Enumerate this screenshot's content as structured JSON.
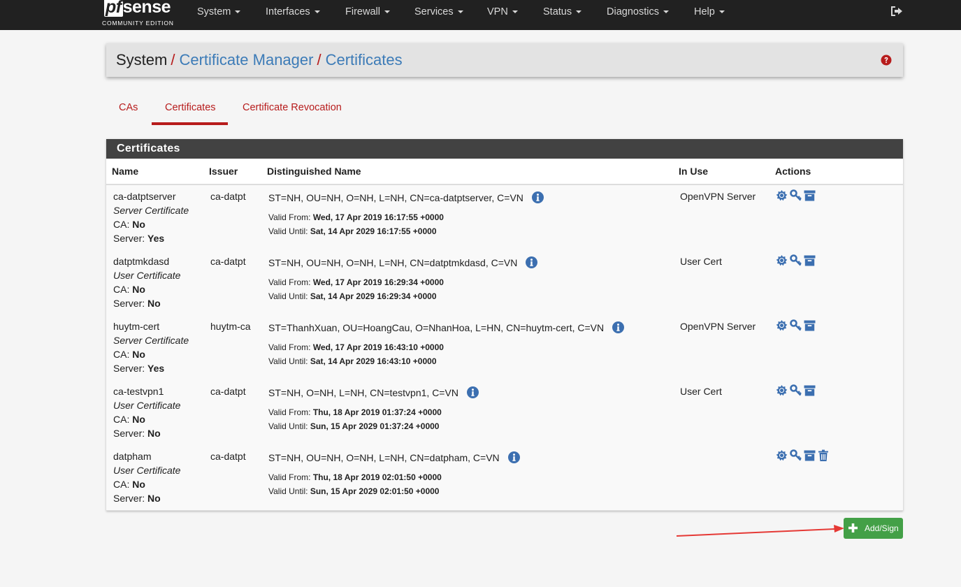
{
  "brand": {
    "name_pf": "pf",
    "name_rest": "sense",
    "edition": "COMMUNITY EDITION"
  },
  "nav": {
    "items": [
      "System",
      "Interfaces",
      "Firewall",
      "Services",
      "VPN",
      "Status",
      "Diagnostics",
      "Help"
    ],
    "logout_icon": "sign-out-icon"
  },
  "breadcrumb": {
    "root": "System",
    "level1": "Certificate Manager",
    "level2": "Certificates",
    "separator": "/",
    "help_icon": "question-circle-icon"
  },
  "tabs": [
    {
      "label": "CAs",
      "active": false
    },
    {
      "label": "Certificates",
      "active": true
    },
    {
      "label": "Certificate Revocation",
      "active": false
    }
  ],
  "panel": {
    "title": "Certificates",
    "columns": [
      "Name",
      "Issuer",
      "Distinguished Name",
      "In Use",
      "Actions"
    ],
    "labels": {
      "ca": "CA:",
      "server": "Server:",
      "valid_from": "Valid From:",
      "valid_until": "Valid Until:"
    },
    "rows": [
      {
        "name": "ca-datptserver",
        "type": "Server Certificate",
        "ca": "No",
        "server": "Yes",
        "issuer": "ca-datpt",
        "dn": "ST=NH, OU=NH, O=NH, L=NH, CN=ca-datptserver, C=VN",
        "valid_from": "Wed, 17 Apr 2019 16:17:55 +0000",
        "valid_until": "Sat, 14 Apr 2029 16:17:55 +0000",
        "in_use": "OpenVPN Server",
        "deletable": false
      },
      {
        "name": "datptmkdasd",
        "type": "User Certificate",
        "ca": "No",
        "server": "No",
        "issuer": "ca-datpt",
        "dn": "ST=NH, OU=NH, O=NH, L=NH, CN=datptmkdasd, C=VN",
        "valid_from": "Wed, 17 Apr 2019 16:29:34 +0000",
        "valid_until": "Sat, 14 Apr 2029 16:29:34 +0000",
        "in_use": "User Cert",
        "deletable": false
      },
      {
        "name": "huytm-cert",
        "type": "Server Certificate",
        "ca": "No",
        "server": "Yes",
        "issuer": "huytm-ca",
        "dn": "ST=ThanhXuan, OU=HoangCau, O=NhanHoa, L=HN, CN=huytm-cert, C=VN",
        "valid_from": "Wed, 17 Apr 2019 16:43:10 +0000",
        "valid_until": "Sat, 14 Apr 2029 16:43:10 +0000",
        "in_use": "OpenVPN Server",
        "deletable": false
      },
      {
        "name": "ca-testvpn1",
        "type": "User Certificate",
        "ca": "No",
        "server": "No",
        "issuer": "ca-datpt",
        "dn": "ST=NH, O=NH, L=NH, CN=testvpn1, C=VN",
        "valid_from": "Thu, 18 Apr 2019 01:37:24 +0000",
        "valid_until": "Sun, 15 Apr 2029 01:37:24 +0000",
        "in_use": "User Cert",
        "deletable": false
      },
      {
        "name": "datpham",
        "type": "User Certificate",
        "ca": "No",
        "server": "No",
        "issuer": "ca-datpt",
        "dn": "ST=NH, OU=NH, O=NH, L=NH, CN=datpham, C=VN",
        "valid_from": "Thu, 18 Apr 2019 02:01:50 +0000",
        "valid_until": "Sun, 15 Apr 2029 02:01:50 +0000",
        "in_use": "",
        "deletable": true
      }
    ],
    "action_icons": [
      "certificate-icon",
      "key-icon",
      "archive-icon",
      "trash-icon"
    ]
  },
  "add_button": {
    "label": "Add/Sign",
    "icon": "plus-icon"
  },
  "annotation": {
    "arrow_color": "#e53935"
  },
  "colors": {
    "navbar": "#212121",
    "accent_red": "#b71c1c",
    "link_blue": "#3c7bb7",
    "panel_header": "#424242",
    "icon_blue": "#3c6fb0",
    "add_green": "#43a047"
  }
}
